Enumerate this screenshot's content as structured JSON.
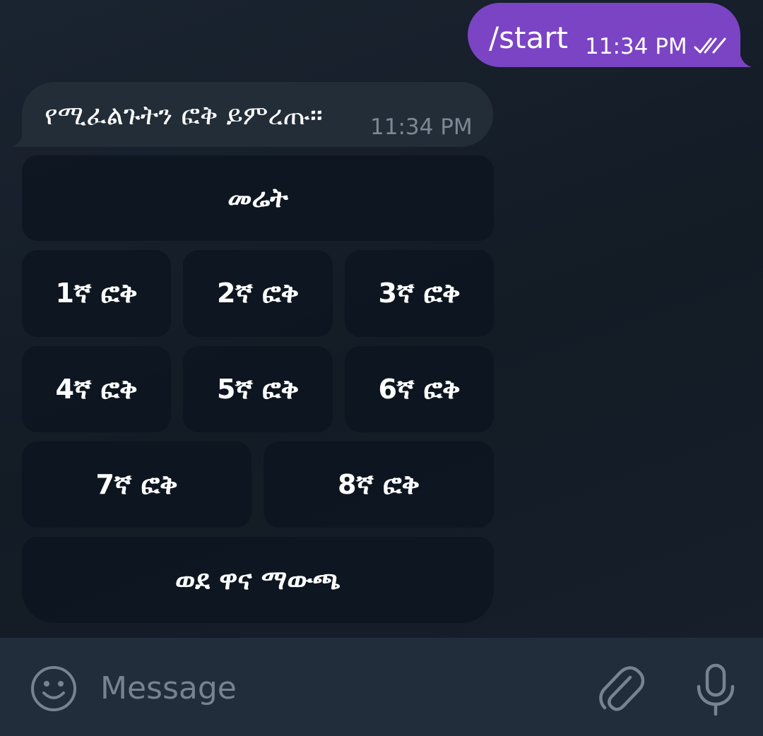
{
  "messages": {
    "outgoing": {
      "text": "/start",
      "time": "11:34 PM",
      "status_icon": "double-check-icon"
    },
    "incoming": {
      "text": "የሚፈልጉትን ፎቅ ይምረጡ።",
      "time": "11:34 PM"
    }
  },
  "keyboard": {
    "rows": [
      [
        "መሬት"
      ],
      [
        "1ኛ ፎቅ",
        "2ኛ ፎቅ",
        "3ኛ ፎቅ"
      ],
      [
        "4ኛ ፎቅ",
        "5ኛ ፎቅ",
        "6ኛ ፎቅ"
      ],
      [
        "7ኛ ፎቅ",
        "8ኛ ፎቅ"
      ],
      [
        "ወደ ዋና ማውጫ"
      ]
    ]
  },
  "input_bar": {
    "placeholder": "Message",
    "left_icon": "emoji-icon",
    "right_icons": [
      "attach-icon",
      "microphone-icon"
    ]
  },
  "colors": {
    "outgoing_bubble": "#7b44c4",
    "incoming_bubble": "#222d38",
    "keyboard_button": "#0c1520",
    "background": "#141c27",
    "input_bar": "#212d3b"
  }
}
